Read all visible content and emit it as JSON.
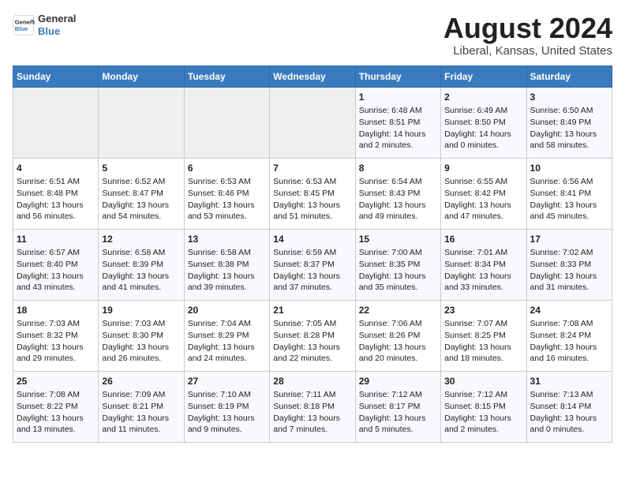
{
  "header": {
    "logo_line1": "General",
    "logo_line2": "Blue",
    "main_title": "August 2024",
    "subtitle": "Liberal, Kansas, United States"
  },
  "days_of_week": [
    "Sunday",
    "Monday",
    "Tuesday",
    "Wednesday",
    "Thursday",
    "Friday",
    "Saturday"
  ],
  "weeks": [
    [
      {
        "day": "",
        "content": ""
      },
      {
        "day": "",
        "content": ""
      },
      {
        "day": "",
        "content": ""
      },
      {
        "day": "",
        "content": ""
      },
      {
        "day": "1",
        "content": "Sunrise: 6:48 AM\nSunset: 8:51 PM\nDaylight: 14 hours\nand 2 minutes."
      },
      {
        "day": "2",
        "content": "Sunrise: 6:49 AM\nSunset: 8:50 PM\nDaylight: 14 hours\nand 0 minutes."
      },
      {
        "day": "3",
        "content": "Sunrise: 6:50 AM\nSunset: 8:49 PM\nDaylight: 13 hours\nand 58 minutes."
      }
    ],
    [
      {
        "day": "4",
        "content": "Sunrise: 6:51 AM\nSunset: 8:48 PM\nDaylight: 13 hours\nand 56 minutes."
      },
      {
        "day": "5",
        "content": "Sunrise: 6:52 AM\nSunset: 8:47 PM\nDaylight: 13 hours\nand 54 minutes."
      },
      {
        "day": "6",
        "content": "Sunrise: 6:53 AM\nSunset: 8:46 PM\nDaylight: 13 hours\nand 53 minutes."
      },
      {
        "day": "7",
        "content": "Sunrise: 6:53 AM\nSunset: 8:45 PM\nDaylight: 13 hours\nand 51 minutes."
      },
      {
        "day": "8",
        "content": "Sunrise: 6:54 AM\nSunset: 8:43 PM\nDaylight: 13 hours\nand 49 minutes."
      },
      {
        "day": "9",
        "content": "Sunrise: 6:55 AM\nSunset: 8:42 PM\nDaylight: 13 hours\nand 47 minutes."
      },
      {
        "day": "10",
        "content": "Sunrise: 6:56 AM\nSunset: 8:41 PM\nDaylight: 13 hours\nand 45 minutes."
      }
    ],
    [
      {
        "day": "11",
        "content": "Sunrise: 6:57 AM\nSunset: 8:40 PM\nDaylight: 13 hours\nand 43 minutes."
      },
      {
        "day": "12",
        "content": "Sunrise: 6:58 AM\nSunset: 8:39 PM\nDaylight: 13 hours\nand 41 minutes."
      },
      {
        "day": "13",
        "content": "Sunrise: 6:58 AM\nSunset: 8:38 PM\nDaylight: 13 hours\nand 39 minutes."
      },
      {
        "day": "14",
        "content": "Sunrise: 6:59 AM\nSunset: 8:37 PM\nDaylight: 13 hours\nand 37 minutes."
      },
      {
        "day": "15",
        "content": "Sunrise: 7:00 AM\nSunset: 8:35 PM\nDaylight: 13 hours\nand 35 minutes."
      },
      {
        "day": "16",
        "content": "Sunrise: 7:01 AM\nSunset: 8:34 PM\nDaylight: 13 hours\nand 33 minutes."
      },
      {
        "day": "17",
        "content": "Sunrise: 7:02 AM\nSunset: 8:33 PM\nDaylight: 13 hours\nand 31 minutes."
      }
    ],
    [
      {
        "day": "18",
        "content": "Sunrise: 7:03 AM\nSunset: 8:32 PM\nDaylight: 13 hours\nand 29 minutes."
      },
      {
        "day": "19",
        "content": "Sunrise: 7:03 AM\nSunset: 8:30 PM\nDaylight: 13 hours\nand 26 minutes."
      },
      {
        "day": "20",
        "content": "Sunrise: 7:04 AM\nSunset: 8:29 PM\nDaylight: 13 hours\nand 24 minutes."
      },
      {
        "day": "21",
        "content": "Sunrise: 7:05 AM\nSunset: 8:28 PM\nDaylight: 13 hours\nand 22 minutes."
      },
      {
        "day": "22",
        "content": "Sunrise: 7:06 AM\nSunset: 8:26 PM\nDaylight: 13 hours\nand 20 minutes."
      },
      {
        "day": "23",
        "content": "Sunrise: 7:07 AM\nSunset: 8:25 PM\nDaylight: 13 hours\nand 18 minutes."
      },
      {
        "day": "24",
        "content": "Sunrise: 7:08 AM\nSunset: 8:24 PM\nDaylight: 13 hours\nand 16 minutes."
      }
    ],
    [
      {
        "day": "25",
        "content": "Sunrise: 7:08 AM\nSunset: 8:22 PM\nDaylight: 13 hours\nand 13 minutes."
      },
      {
        "day": "26",
        "content": "Sunrise: 7:09 AM\nSunset: 8:21 PM\nDaylight: 13 hours\nand 11 minutes."
      },
      {
        "day": "27",
        "content": "Sunrise: 7:10 AM\nSunset: 8:19 PM\nDaylight: 13 hours\nand 9 minutes."
      },
      {
        "day": "28",
        "content": "Sunrise: 7:11 AM\nSunset: 8:18 PM\nDaylight: 13 hours\nand 7 minutes."
      },
      {
        "day": "29",
        "content": "Sunrise: 7:12 AM\nSunset: 8:17 PM\nDaylight: 13 hours\nand 5 minutes."
      },
      {
        "day": "30",
        "content": "Sunrise: 7:12 AM\nSunset: 8:15 PM\nDaylight: 13 hours\nand 2 minutes."
      },
      {
        "day": "31",
        "content": "Sunrise: 7:13 AM\nSunset: 8:14 PM\nDaylight: 13 hours\nand 0 minutes."
      }
    ]
  ]
}
